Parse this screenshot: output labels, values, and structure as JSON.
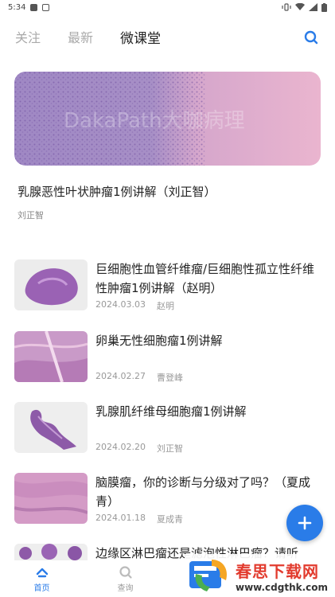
{
  "status": {
    "time": "5:34"
  },
  "tabs": [
    {
      "label": "关注"
    },
    {
      "label": "最新"
    },
    {
      "label": "微课堂"
    }
  ],
  "hero": {
    "watermark_text": "DakaPath大咖病理",
    "title": "乳腺恶性叶状肿瘤1例讲解（刘正智）",
    "author": "刘正智"
  },
  "items": [
    {
      "title": "巨细胞性血管纤维瘤/巨细胞性孤立性纤维性肿瘤1例讲解（赵明）",
      "date": "2024.03.03",
      "author": "赵明"
    },
    {
      "title": "卵巢无性细胞瘤1例讲解",
      "date": "2024.02.27",
      "author": "曹登峰"
    },
    {
      "title": "乳腺肌纤维母细胞瘤1例讲解",
      "date": "2024.02.20",
      "author": "刘正智"
    },
    {
      "title": "脑膜瘤，你的诊断与分级对了吗？（夏成青）",
      "date": "2024.01.18",
      "author": "夏成青"
    },
    {
      "title": "边缘区淋巴瘤还是滤泡性淋巴瘤？请听",
      "date": "",
      "author": ""
    }
  ],
  "bottom_nav": [
    {
      "label": "首页",
      "icon": "home-icon"
    },
    {
      "label": "查询",
      "icon": "search-icon"
    },
    {
      "label": "",
      "icon": ""
    },
    {
      "label": "",
      "icon": ""
    }
  ],
  "site_watermark": {
    "name": "春思下载网",
    "url": "www.cdgthk.com"
  },
  "colors": {
    "accent": "#2a7ce8",
    "hero_purple": "#8e74b8",
    "hero_pink": "#e6a9c8"
  }
}
